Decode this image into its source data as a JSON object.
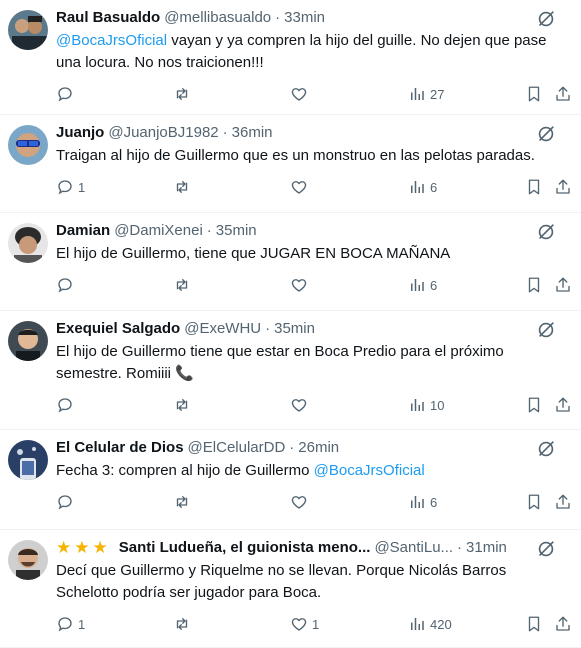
{
  "tweets": [
    {
      "name": "Raul Basualdo",
      "handle": "@mellibasualdo",
      "time": "33min",
      "text_mention": "@BocaJrsOficial",
      "text": " vayan y ya compren la hijo del guille. No dejen que pase una locura. No nos traicionen!!!",
      "replies": "",
      "retweets": "",
      "likes": "",
      "views": "27"
    },
    {
      "name": "Juanjo",
      "handle": "@JuanjoBJ1982",
      "time": "36min",
      "text": "Traigan al hijo de Guillermo que es un monstruo en las pelotas paradas.",
      "replies": "1",
      "retweets": "",
      "likes": "",
      "views": "6"
    },
    {
      "name": "Damian",
      "handle": "@DamiXenei",
      "time": "35min",
      "text": "El hijo de Guillermo, tiene que JUGAR EN BOCA MAÑANA",
      "replies": "",
      "retweets": "",
      "likes": "",
      "views": "6"
    },
    {
      "name": "Exequiel Salgado",
      "handle": "@ExeWHU",
      "time": "35min",
      "text": "El hijo de Guillermo tiene que estar en Boca Predio para el próximo semestre. Romiiii 📞",
      "replies": "",
      "retweets": "",
      "likes": "",
      "views": "10"
    },
    {
      "name": "El Celular de Dios",
      "handle": "@ElCelularDD",
      "time": "26min",
      "text": "Fecha 3: compren al hijo de Guillermo ",
      "text_mention_end": "@BocaJrsOficial",
      "replies": "",
      "retweets": "",
      "likes": "",
      "views": "6"
    },
    {
      "stars": "★★★",
      "name": "Santi Ludueña, el guionista meno...",
      "handle": "@SantiLu...",
      "time": "31min",
      "text": "Decí que Guillermo y Riquelme no se llevan. Porque Nicolás Barros Schelotto podría ser jugador para Boca.",
      "replies": "1",
      "retweets": "",
      "likes": "1",
      "views": "420"
    }
  ],
  "separator": "·",
  "icons": {
    "reply": "reply-icon",
    "retweet": "retweet-icon",
    "like": "heart-icon",
    "views": "views-icon",
    "bookmark": "bookmark-icon",
    "share": "share-icon",
    "grok": "grok-icon"
  },
  "colors": {
    "link": "#1d9bf0",
    "muted": "#536471",
    "text": "#0f1419",
    "star": "#f4b400"
  }
}
